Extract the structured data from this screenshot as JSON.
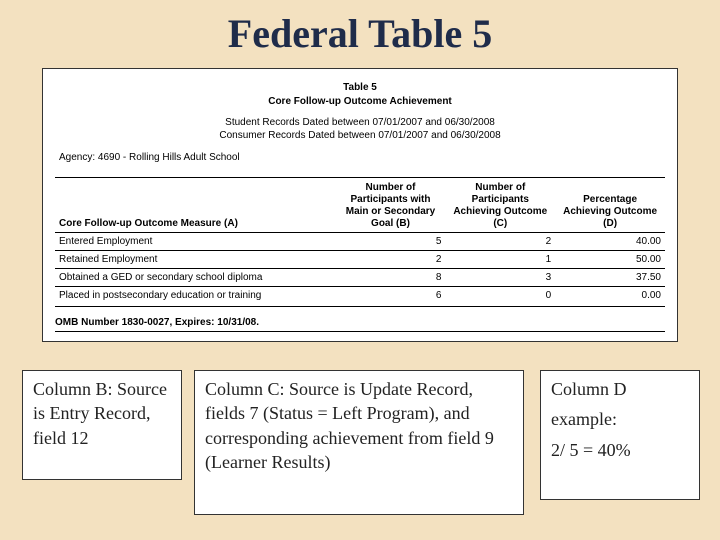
{
  "title": "Federal Table 5",
  "embed": {
    "table_caption": "Table 5",
    "table_subtitle": "Core Follow-up Outcome Achievement",
    "date_line1": "Student Records Dated between 07/01/2007 and 06/30/2008",
    "date_line2": "Consumer Records Dated between 07/01/2007 and 06/30/2008",
    "agency": "Agency:   4690 - Rolling Hills Adult School",
    "headers": {
      "A": "Core Follow-up Outcome Measure\n(A)",
      "B": "Number of Participants with Main or Secondary Goal\n(B)",
      "C": "Number of Participants Achieving Outcome\n(C)",
      "D": "Percentage Achieving Outcome\n(D)"
    },
    "rows": [
      {
        "label": "Entered Employment",
        "b": "5",
        "c": "2",
        "d": "40.00"
      },
      {
        "label": "Retained Employment",
        "b": "2",
        "c": "1",
        "d": "50.00"
      },
      {
        "label": "Obtained a GED or secondary school diploma",
        "b": "8",
        "c": "3",
        "d": "37.50"
      },
      {
        "label": "Placed in postsecondary education or training",
        "b": "6",
        "c": "0",
        "d": "0.00"
      }
    ],
    "omb": "OMB Number 1830-0027, Expires: 10/31/08."
  },
  "annotations": {
    "b": "Column B: Source is Entry Record, field 12",
    "c": "Column C: Source is Update Record, fields 7 (Status = Left Program), and corresponding achievement from field 9 (Learner Results)",
    "d_line1": "Column D",
    "d_line2": "example:",
    "d_line3": "2/ 5 = 40%"
  }
}
